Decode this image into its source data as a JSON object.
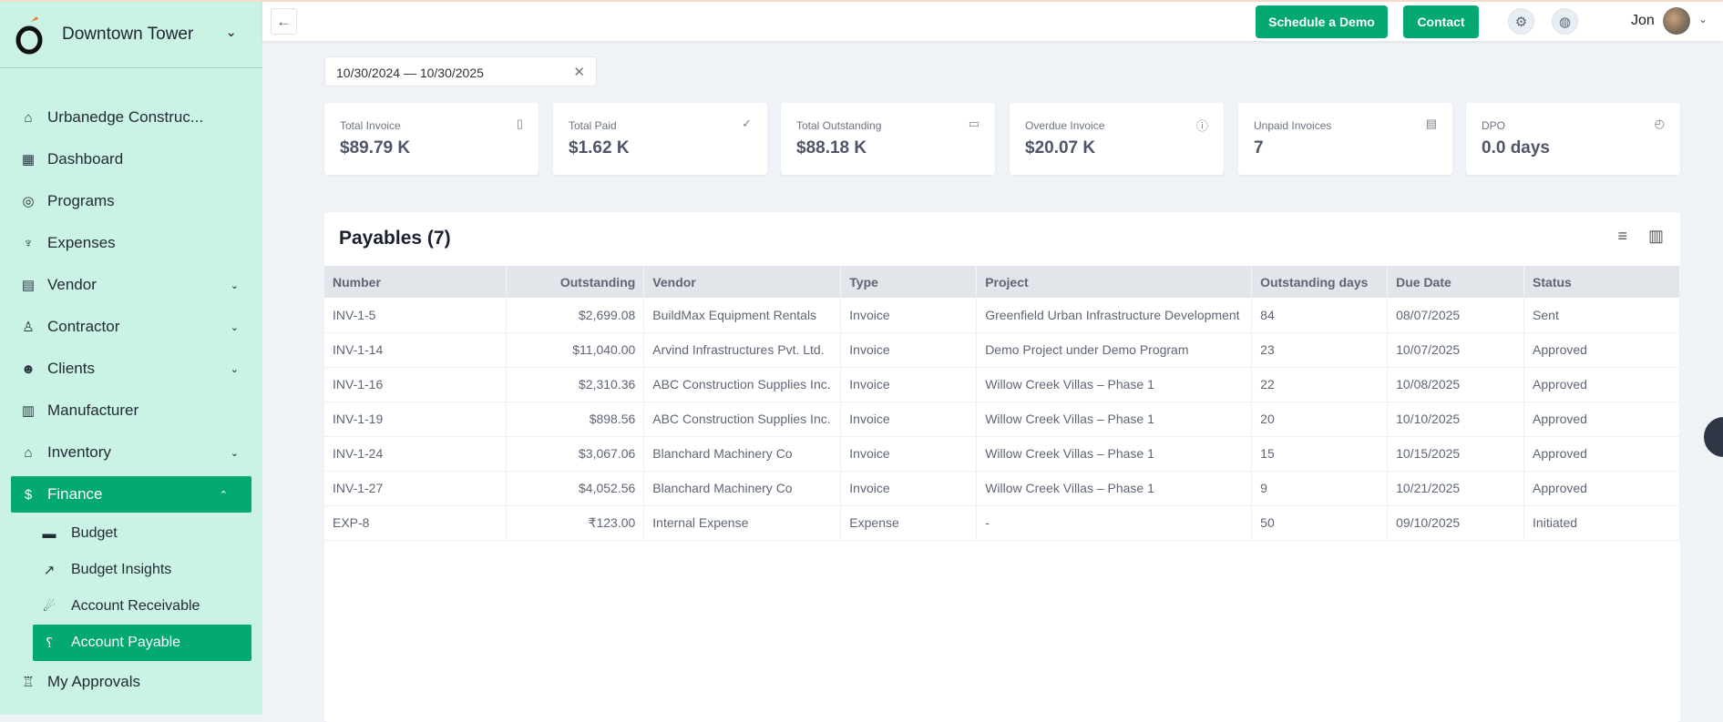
{
  "sidebar": {
    "project": "Downtown Tower",
    "items": [
      {
        "label": "Urbanedge Construc...",
        "icon": "home-icon"
      },
      {
        "label": "Dashboard",
        "icon": "dashboard-icon"
      },
      {
        "label": "Programs",
        "icon": "programs-icon"
      },
      {
        "label": "Expenses",
        "icon": "expenses-icon"
      },
      {
        "label": "Vendor",
        "icon": "store-icon"
      },
      {
        "label": "Contractor",
        "icon": "user-icon"
      },
      {
        "label": "Clients",
        "icon": "users-icon"
      },
      {
        "label": "Manufacturer",
        "icon": "factory-icon"
      },
      {
        "label": "Inventory",
        "icon": "warehouse-icon"
      },
      {
        "label": "Finance",
        "icon": "dollar-icon"
      }
    ],
    "finance_items": [
      {
        "label": "Budget"
      },
      {
        "label": "Budget Insights"
      },
      {
        "label": "Account Receivable"
      },
      {
        "label": "Account Payable"
      }
    ],
    "approvals": "My Approvals"
  },
  "header": {
    "schedule_demo": "Schedule a Demo",
    "contact": "Contact",
    "user": "Jon"
  },
  "date_range": "10/30/2024 — 10/30/2025",
  "cards": [
    {
      "label": "Total Invoice",
      "value": "$89.79 K"
    },
    {
      "label": "Total Paid",
      "value": "$1.62 K"
    },
    {
      "label": "Total Outstanding",
      "value": "$88.18 K"
    },
    {
      "label": "Overdue Invoice",
      "value": "$20.07 K"
    },
    {
      "label": "Unpaid Invoices",
      "value": "7"
    },
    {
      "label": "DPO",
      "value": "0.0 days"
    }
  ],
  "payables": {
    "title": "Payables (7)",
    "columns": [
      "Number",
      "Outstanding",
      "Vendor",
      "Type",
      "Project",
      "Outstanding days",
      "Due Date",
      "Status"
    ],
    "rows": [
      [
        "INV-1-5",
        "$2,699.08",
        "BuildMax Equipment Rentals",
        "Invoice",
        "Greenfield Urban Infrastructure Development",
        "84",
        "08/07/2025",
        "Sent"
      ],
      [
        "INV-1-14",
        "$11,040.00",
        "Arvind Infrastructures Pvt. Ltd.",
        "Invoice",
        "Demo Project under Demo Program",
        "23",
        "10/07/2025",
        "Approved"
      ],
      [
        "INV-1-16",
        "$2,310.36",
        "ABC Construction Supplies Inc.",
        "Invoice",
        "Willow Creek Villas – Phase 1",
        "22",
        "10/08/2025",
        "Approved"
      ],
      [
        "INV-1-19",
        "$898.56",
        "ABC Construction Supplies Inc.",
        "Invoice",
        "Willow Creek Villas – Phase 1",
        "20",
        "10/10/2025",
        "Approved"
      ],
      [
        "INV-1-24",
        "$3,067.06",
        "Blanchard Machinery Co",
        "Invoice",
        "Willow Creek Villas – Phase 1",
        "15",
        "10/15/2025",
        "Approved"
      ],
      [
        "INV-1-27",
        "$4,052.56",
        "Blanchard Machinery Co",
        "Invoice",
        "Willow Creek Villas – Phase 1",
        "9",
        "10/21/2025",
        "Approved"
      ],
      [
        "EXP-8",
        "₹123.00",
        "Internal Expense",
        "Expense",
        "-",
        "50",
        "09/10/2025",
        "Initiated"
      ]
    ]
  },
  "colors": {
    "accent": "#03a872",
    "sidebar": "#cbf3e5"
  }
}
